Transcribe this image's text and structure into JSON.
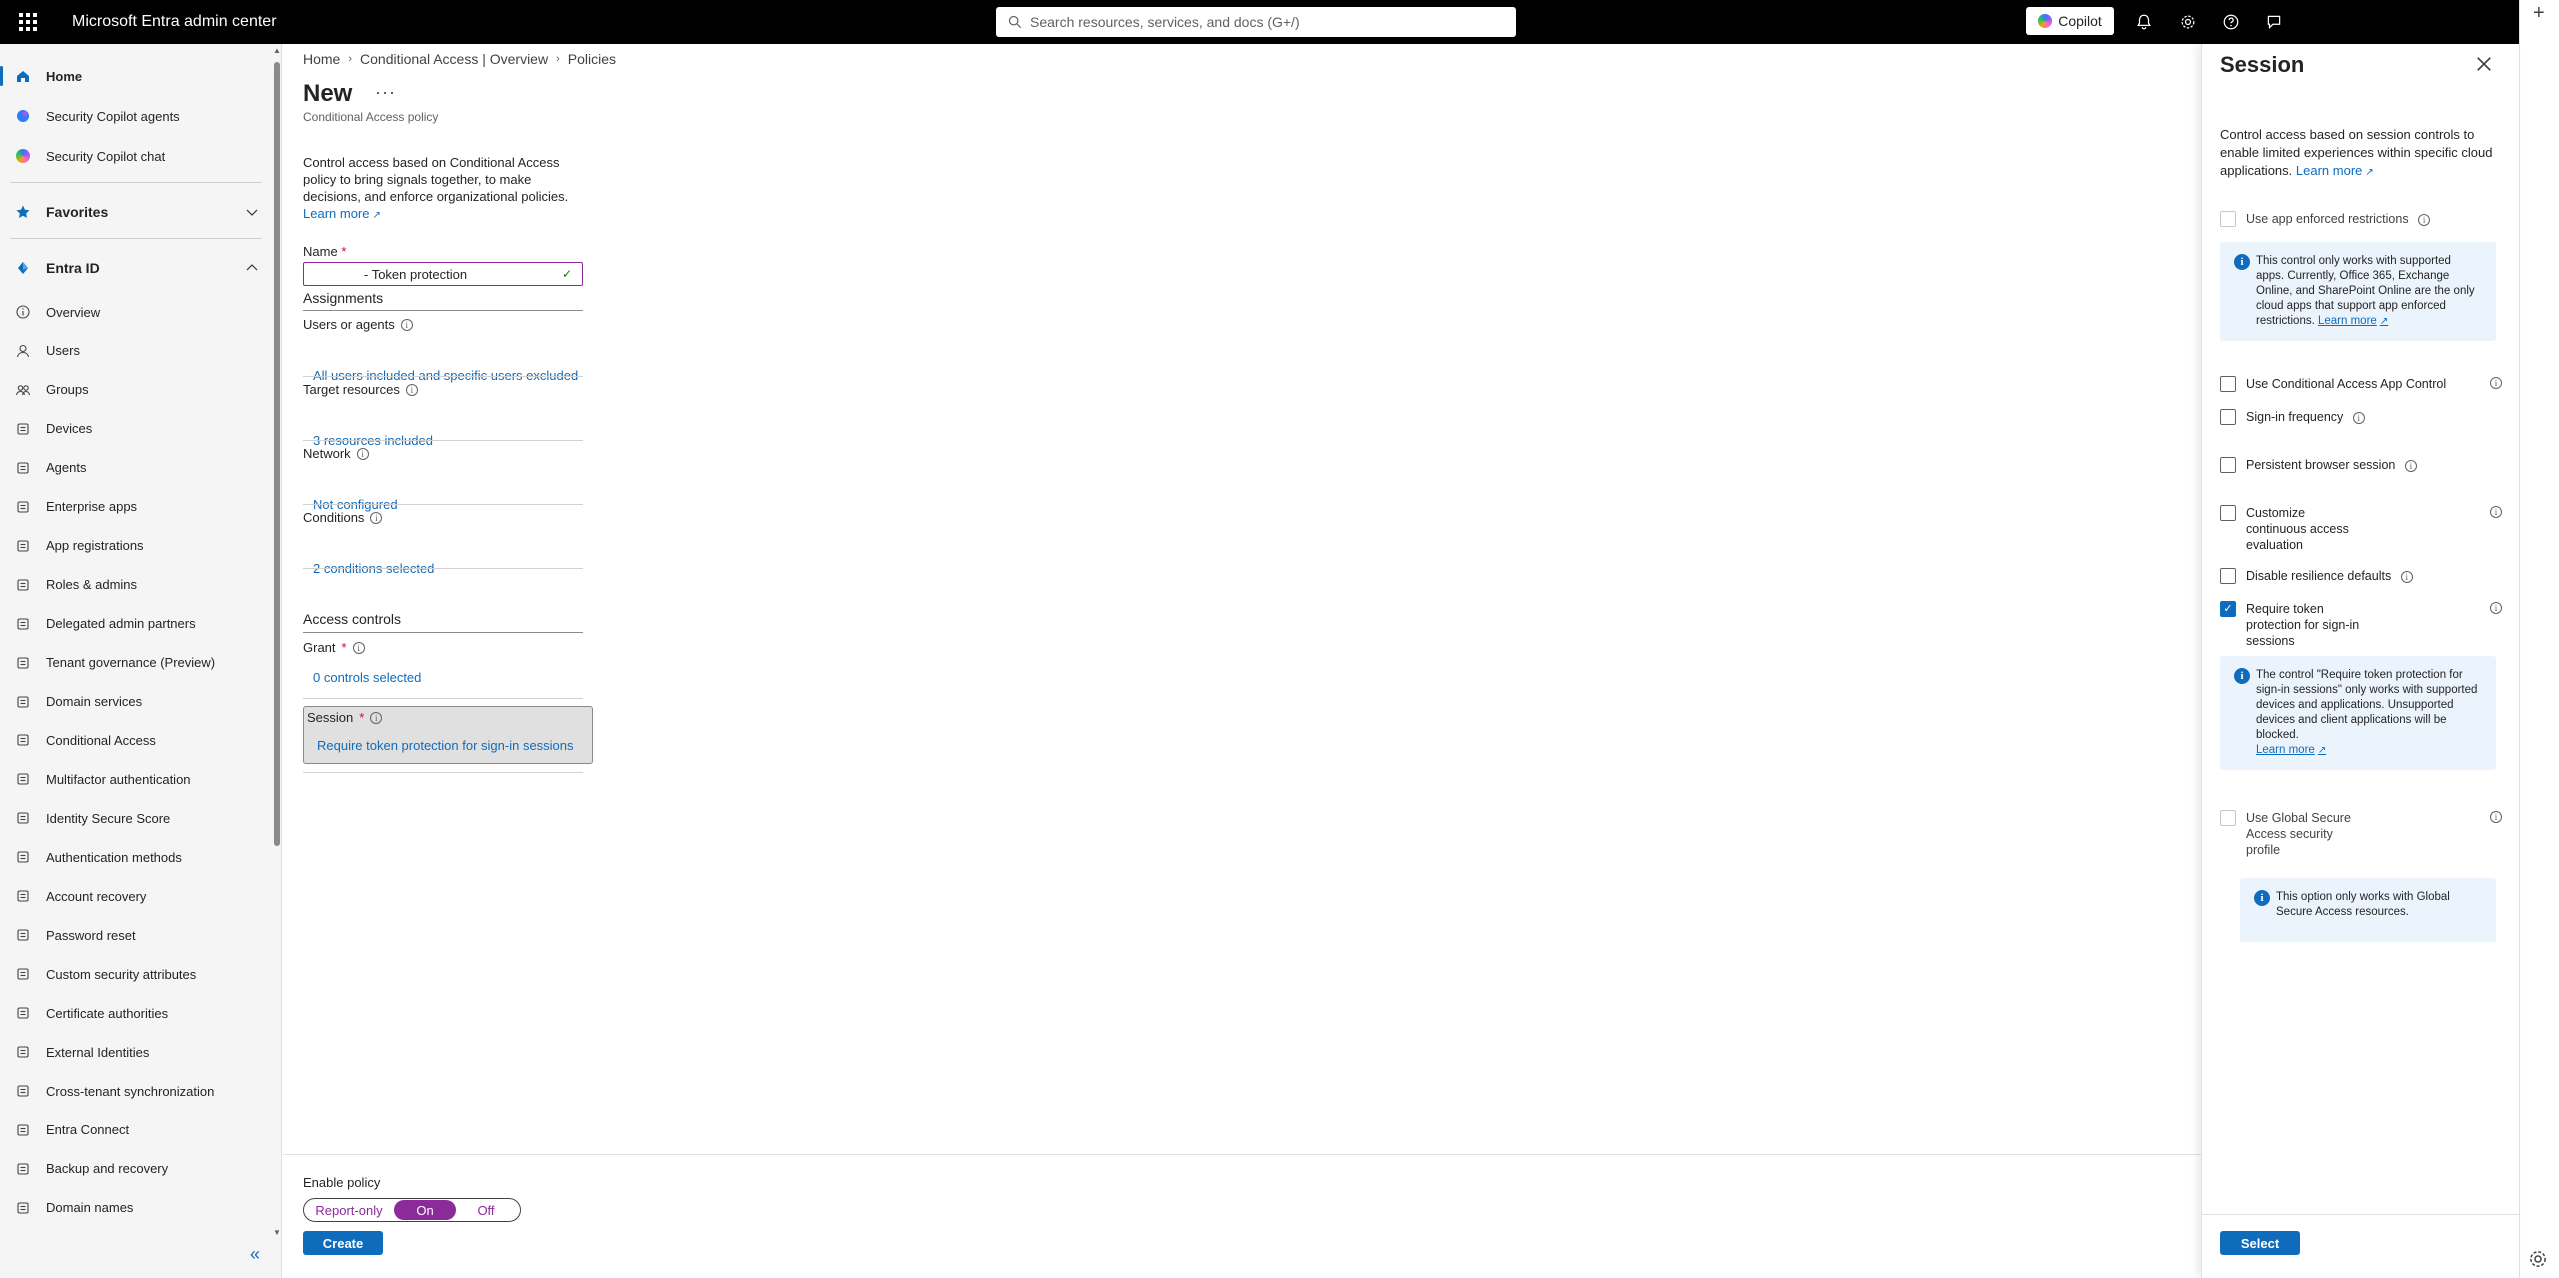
{
  "topbar": {
    "app_title": "Microsoft Entra admin center",
    "search_placeholder": "Search resources, services, and docs (G+/)",
    "copilot_label": "Copilot"
  },
  "sidebar": {
    "home": "Home",
    "security_copilot_agents": "Security Copilot agents",
    "security_copilot_chat": "Security Copilot chat",
    "favorites": "Favorites",
    "entra_id": "Entra ID",
    "items": [
      {
        "label": "Overview",
        "icon": "info-icon"
      },
      {
        "label": "Users",
        "icon": "user-icon"
      },
      {
        "label": "Groups",
        "icon": "groups-icon"
      },
      {
        "label": "Devices",
        "icon": "devices-icon"
      },
      {
        "label": "Agents",
        "icon": "agents-icon"
      },
      {
        "label": "Enterprise apps",
        "icon": "apps-icon"
      },
      {
        "label": "App registrations",
        "icon": "app-registrations-icon"
      },
      {
        "label": "Roles & admins",
        "icon": "roles-icon"
      },
      {
        "label": "Delegated admin partners",
        "icon": "partners-icon"
      },
      {
        "label": "Tenant governance (Preview)",
        "icon": "governance-icon"
      },
      {
        "label": "Domain services",
        "icon": "domain-icon"
      },
      {
        "label": "Conditional Access",
        "icon": "conditional-access-icon"
      },
      {
        "label": "Multifactor authentication",
        "icon": "mfa-icon"
      },
      {
        "label": "Identity Secure Score",
        "icon": "score-icon"
      },
      {
        "label": "Authentication methods",
        "icon": "auth-methods-icon"
      },
      {
        "label": "Account recovery",
        "icon": "account-recovery-icon"
      },
      {
        "label": "Password reset",
        "icon": "password-reset-icon"
      },
      {
        "label": "Custom security attributes",
        "icon": "attributes-icon"
      },
      {
        "label": "Certificate authorities",
        "icon": "certificate-icon"
      },
      {
        "label": "External Identities",
        "icon": "external-identities-icon"
      },
      {
        "label": "Cross-tenant synchronization",
        "icon": "sync-icon"
      },
      {
        "label": "Entra Connect",
        "icon": "connect-icon"
      },
      {
        "label": "Backup and recovery",
        "icon": "backup-icon"
      },
      {
        "label": "Domain names",
        "icon": "domain-names-icon"
      }
    ]
  },
  "main": {
    "breadcrumb": [
      "Home",
      "Conditional Access | Overview",
      "Policies"
    ],
    "title": "New",
    "subtitle": "Conditional Access policy",
    "description": "Control access based on Conditional Access policy to bring signals together, to make decisions, and enforce organizational policies.",
    "learn_more": "Learn more",
    "name_label": "Name",
    "name_value": "- Token protection",
    "assignments": "Assignments",
    "users_label": "Users or agents",
    "users_value": "All users included and specific users excluded",
    "target_label": "Target resources",
    "target_value": "3 resources included",
    "network_label": "Network",
    "network_value": "Not configured",
    "conditions_label": "Conditions",
    "conditions_value": "2 conditions selected",
    "access_controls": "Access controls",
    "grant_label": "Grant",
    "grant_value": "0 controls selected",
    "session_label": "Session",
    "session_value": "Require token protection for sign-in sessions",
    "enable_policy": "Enable policy",
    "toggle": {
      "report_only": "Report-only",
      "on": "On",
      "off": "Off"
    },
    "create": "Create"
  },
  "panel": {
    "title": "Session",
    "description": "Control access based on session controls to enable limited experiences within specific cloud applications.",
    "learn_more": "Learn more",
    "options": {
      "app_enforced": "Use app enforced restrictions",
      "app_enforced_info": "This control only works with supported apps. Currently, Office 365, Exchange Online, and SharePoint Online are the only cloud apps that support app enforced restrictions.",
      "app_control": "Use Conditional Access App Control",
      "signin_frequency": "Sign-in frequency",
      "persistent": "Persistent browser session",
      "cae": "Customize continuous access evaluation",
      "resilience": "Disable resilience defaults",
      "token_protection": "Require token protection for sign-in sessions",
      "token_info": "The control \"Require token protection for sign-in sessions\" only works with supported devices and applications. Unsupported devices and client applications will be blocked.",
      "gsa": "Use Global Secure Access security profile",
      "gsa_info": "This option only works with Global Secure Access resources."
    },
    "select": "Select"
  },
  "colors": {
    "accent": "#0f6cbd",
    "toggle_on": "#8c2a9c",
    "required": "#c50f1f"
  }
}
